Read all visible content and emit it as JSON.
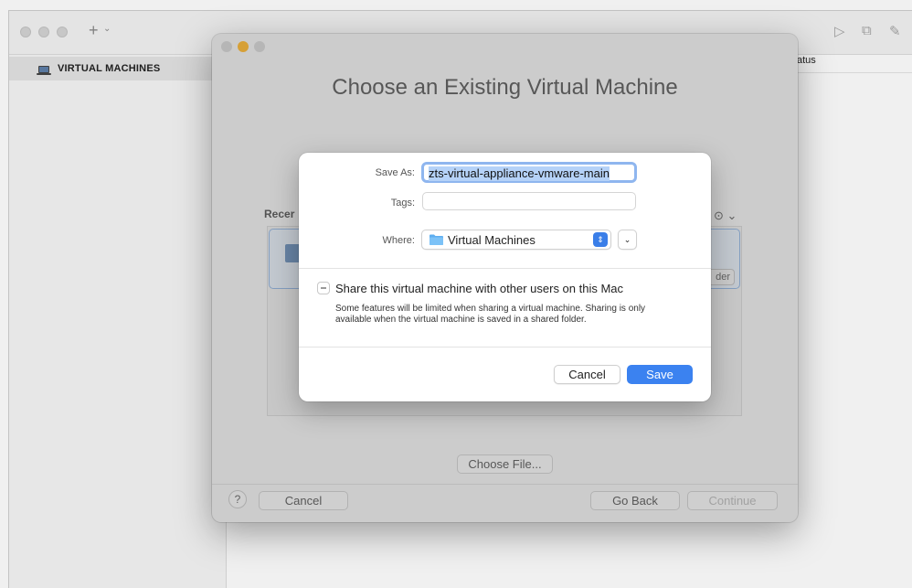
{
  "window": {
    "sidebar_title": "VIRTUAL MACHINES",
    "add_label": "+",
    "add_chevron": "⌄",
    "column_header": "atus"
  },
  "assistant": {
    "title": "Choose an Existing Virtual Machine",
    "recent_label": "Recer",
    "folder_button": "der",
    "ellipsis": "⊙ ⌄",
    "choose_file": "Choose File...",
    "help": "?",
    "cancel": "Cancel",
    "go_back": "Go Back",
    "continue": "Continue"
  },
  "save_dialog": {
    "save_as_label": "Save As:",
    "save_as_value": "zts-virtual-appliance-vmware-main",
    "tags_label": "Tags:",
    "tags_value": "",
    "where_label": "Where:",
    "where_value": "Virtual Machines",
    "share_label": "Share this virtual machine with other users on this Mac",
    "share_description": "Some features will be limited when sharing a virtual machine. Sharing is only available when the virtual machine is saved in a shared folder.",
    "cancel": "Cancel",
    "save": "Save"
  },
  "colors": {
    "accent": "#3b82f0",
    "selection": "#b5d2f8",
    "focus_ring": "#8fb6ef"
  }
}
